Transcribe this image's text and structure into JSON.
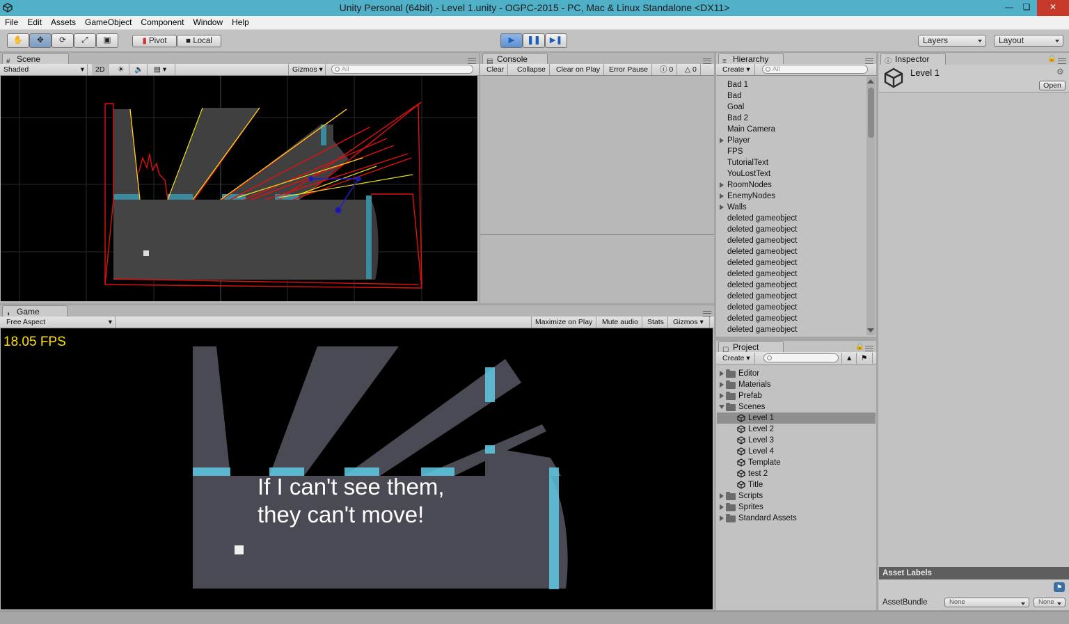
{
  "window": {
    "title": "Unity Personal (64bit) - Level 1.unity - OGPC-2015 - PC, Mac & Linux Standalone <DX11>"
  },
  "menu": [
    "File",
    "Edit",
    "Assets",
    "GameObject",
    "Component",
    "Window",
    "Help"
  ],
  "toolbar": {
    "pivot": "Pivot",
    "local": "Local",
    "layers": "Layers",
    "layout": "Layout"
  },
  "scene": {
    "tab": "Scene",
    "shading": "Shaded",
    "mode2d": "2D",
    "gizmos": "Gizmos",
    "search_placeholder": "All"
  },
  "console": {
    "tab": "Console",
    "clear": "Clear",
    "collapse": "Collapse",
    "clear_on_play": "Clear on Play",
    "error_pause": "Error Pause",
    "info_count": "0",
    "warning_count": "0"
  },
  "hierarchy": {
    "tab": "Hierarchy",
    "create": "Create",
    "search_placeholder": "All",
    "items": [
      {
        "label": "Bad 1",
        "expandable": false
      },
      {
        "label": "Bad",
        "expandable": false
      },
      {
        "label": "Goal",
        "expandable": false
      },
      {
        "label": "Bad 2",
        "expandable": false
      },
      {
        "label": "Main Camera",
        "expandable": false
      },
      {
        "label": "Player",
        "expandable": true
      },
      {
        "label": "FPS",
        "expandable": false
      },
      {
        "label": "TutorialText",
        "expandable": false
      },
      {
        "label": "YouLostText",
        "expandable": false
      },
      {
        "label": "RoomNodes",
        "expandable": true
      },
      {
        "label": "EnemyNodes",
        "expandable": true
      },
      {
        "label": "Walls",
        "expandable": true
      },
      {
        "label": "deleted gameobject",
        "expandable": false
      },
      {
        "label": "deleted gameobject",
        "expandable": false
      },
      {
        "label": "deleted gameobject",
        "expandable": false
      },
      {
        "label": "deleted gameobject",
        "expandable": false
      },
      {
        "label": "deleted gameobject",
        "expandable": false
      },
      {
        "label": "deleted gameobject",
        "expandable": false
      },
      {
        "label": "deleted gameobject",
        "expandable": false
      },
      {
        "label": "deleted gameobject",
        "expandable": false
      },
      {
        "label": "deleted gameobject",
        "expandable": false
      },
      {
        "label": "deleted gameobject",
        "expandable": false
      },
      {
        "label": "deleted gameobject",
        "expandable": false
      }
    ]
  },
  "inspector": {
    "tab": "Inspector",
    "object_name": "Level 1",
    "open": "Open",
    "asset_labels": "Asset Labels",
    "asset_bundle": "AssetBundle",
    "bundle_value": "None",
    "variant_value": "None"
  },
  "game": {
    "tab": "Game",
    "aspect": "Free Aspect",
    "maximize_on_play": "Maximize on Play",
    "mute_audio": "Mute audio",
    "stats": "Stats",
    "gizmos": "Gizmos",
    "fps": "18.05 FPS",
    "tutorial_line1": "If I can't see them,",
    "tutorial_line2": "they can't move!"
  },
  "project": {
    "tab": "Project",
    "create": "Create",
    "folders": [
      {
        "label": "Editor",
        "expanded": false
      },
      {
        "label": "Materials",
        "expanded": false
      },
      {
        "label": "Prefab",
        "expanded": false
      },
      {
        "label": "Scenes",
        "expanded": true
      }
    ],
    "scenes": [
      {
        "label": "Level 1",
        "selected": true
      },
      {
        "label": "Level 2",
        "selected": false
      },
      {
        "label": "Level 3",
        "selected": false
      },
      {
        "label": "Level 4",
        "selected": false
      },
      {
        "label": "Template",
        "selected": false
      },
      {
        "label": "test 2",
        "selected": false
      },
      {
        "label": "Title",
        "selected": false
      }
    ],
    "folders_after": [
      {
        "label": "Scripts"
      },
      {
        "label": "Sprites"
      },
      {
        "label": "Standard Assets"
      }
    ]
  },
  "colors": {
    "titlebar": "#4fb0c8",
    "play_active": "#3b7fd0",
    "fps_text": "#ffe200",
    "room_fill": "#4a4a55",
    "wall_cyan": "#5fc9e6",
    "scene_red": "#e31010",
    "scene_yellow": "#f2e020"
  }
}
